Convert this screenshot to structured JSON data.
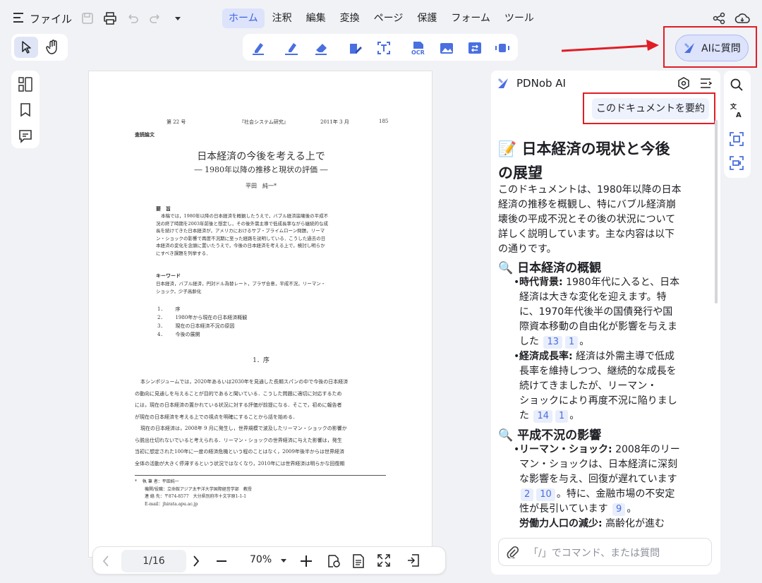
{
  "menu": {
    "file_label": "ファイル"
  },
  "tabs": [
    {
      "label": "ホーム",
      "active": true
    },
    {
      "label": "注釈"
    },
    {
      "label": "編集"
    },
    {
      "label": "変換"
    },
    {
      "label": "ページ"
    },
    {
      "label": "保護"
    },
    {
      "label": "フォーム"
    },
    {
      "label": "ツール"
    }
  ],
  "toolbar_icons": [
    "highlight-icon",
    "underline-icon",
    "eraser-icon",
    "edit-icon",
    "text-recognize-icon",
    "ocr-icon",
    "image-icon",
    "compare-icon",
    "video-icon"
  ],
  "ask_ai_button": {
    "label": "AIに質問"
  },
  "document": {
    "header": {
      "issue": "第 22 号",
      "journal": "『社会システム研究』",
      "date": "2011年 3 月",
      "page": "185"
    },
    "category": "査読論文",
    "title": "日本経済の今後を考える上で",
    "subtitle": "― 1980年以降の推移と現状の評価 ―",
    "author": "平田　純一*",
    "abstract_label": "要　旨",
    "abstract_lines": [
      "本稿では，1980年以降の日本経済を概観したうえで，バブル経済崩壊後の平成不",
      "況の終了時期を2003年前後と想定し，その後外需主導で低成長率ながら継続的な成",
      "長を続けてきた日本経済が，アメリカにおけるサブ・プライムローン問題，リーマ",
      "ン・ショックの影響で再度不況期に至った経路を説明している．こうした過去の日",
      "本経済の変化を念頭に置いたうえで，今後の日本経済を考える上で，検討し明らか",
      "にすべき課題を列挙する．"
    ],
    "keywords_label": "キーワード",
    "keywords_lines": [
      "日本経済，バブル経済，円対ドル為替レート，プラザ合意，平成不況，リーマン・",
      "ショック，少子高齢化"
    ],
    "toc": [
      {
        "num": "1．",
        "text": "序"
      },
      {
        "num": "2．",
        "text": "1980年から現在の日本経済概観"
      },
      {
        "num": "3．",
        "text": "現在の日本経済不況の原因"
      },
      {
        "num": "4．",
        "text": "今後の展開"
      }
    ],
    "section_title": "1．序",
    "body_lines": [
      "本シンポジュームでは，2020年あるいは2030年を見通した長期スパンの中で今後の日本経済",
      "の動向に見通しを与えることが目的であると聞いている．こうした問題に適切に対応するため",
      "には，現在の日本経済の置かれている状況に対する評価が前提になる．そこで，初めに報告者",
      "が現在の日本経済を考える上での視点を明確にすることから話を始める．",
      "現在の日本経済は，2008年 9 月に発生し，世界規模で波及したリーマン・ショックの影響か",
      "ら脱出仕切れないでいると考えられる．リーマン・ショックの世界経済に与えた影響は，発生",
      "当初に想定された100年に一度の経済危機という程のことはなく，2009年後半からは世界経済",
      "全体の活動が大きく停滞するという状況ではなくなり，2010年には世界経済は明らかな回復期"
    ],
    "footnote_lines": [
      "*　 執 筆 者：平田純一",
      "機関/役職：立命館アジア太平洋大学国際経営学部　教授",
      "連 絡 先：〒874-8577　大分県別府市十文字原1-1-1",
      "E-mail：jhirata.apu.ac.jp"
    ]
  },
  "pager": {
    "page": "1/16",
    "zoom": "70%"
  },
  "ai_panel": {
    "title": "PDNob AI",
    "summarize_button": "このドキュメントを要約",
    "heading_line1": "📝 日本経済の現状と今後",
    "heading_line2": "の展望",
    "intro_lines": [
      "このドキュメントは、1980年以降の日本",
      "経済の推移を概観し、特にバブル経済崩",
      "壊後の平成不況とその後の状況について",
      "詳しく説明しています。主な内容は以下",
      "の通りです。"
    ],
    "section1_title": "🔍 日本経済の概観",
    "s1_b1_label": "時代背景:",
    "s1_b1_lines": [
      "1980年代に入ると、日本",
      "経済は大きな変化を迎えます。特",
      "に、1970年代後半の国債発行や国",
      "際資本移動の自由化が影響を与えま",
      "した"
    ],
    "s1_b1_refs": [
      "13",
      "1"
    ],
    "s1_b2_label": "経済成長率:",
    "s1_b2_lines": [
      "経済は外需主導で低成",
      "長率を維持しつつ、継続的な成長を",
      "続けてきましたが、リーマン・",
      "ショックにより再度不況に陥りまし",
      "た"
    ],
    "s1_b2_refs": [
      "14",
      "1"
    ],
    "section2_title": "🔍 平成不況の影響",
    "s2_b1_label": "リーマン・ショック:",
    "s2_b1_lines": [
      "2008年のリー",
      "マン・ショックは、日本経済に深刻",
      "な影響を与え、回復が遅れています"
    ],
    "s2_b1_refs": [
      "2",
      "10"
    ],
    "s2_b1_cont": "。特に、金融市場の不安定",
    "s2_b1_last": "性が長引いています",
    "s2_b1_ref3": "9",
    "s2_b2_label": "労働力人口の減少:",
    "s2_b2_text": "高齢化が進む",
    "period": "。",
    "input_placeholder": "「/」でコマンド、または質問"
  }
}
